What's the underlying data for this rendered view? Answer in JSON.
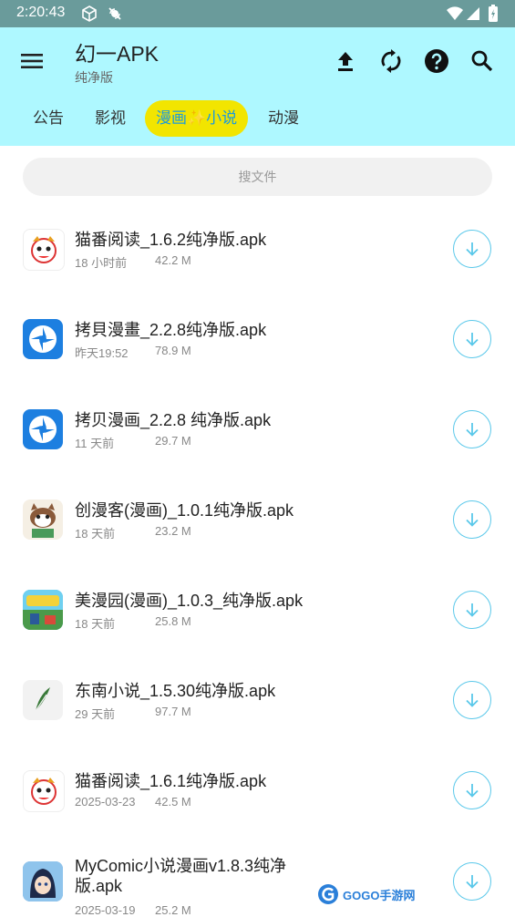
{
  "status_bar": {
    "time": "2:20:43"
  },
  "app_bar": {
    "title": "幻一APK",
    "subtitle": "纯净版",
    "actions": [
      "upload-icon",
      "sync-icon",
      "help-icon",
      "search-icon"
    ]
  },
  "tabs": [
    {
      "label": "公告",
      "active": false
    },
    {
      "label": "影视",
      "active": false
    },
    {
      "label": "漫画✨小说",
      "active": true
    },
    {
      "label": "动漫",
      "active": false
    }
  ],
  "search": {
    "placeholder": "搜文件"
  },
  "files": [
    {
      "name": "猫番阅读_1.6.2纯净版.apk",
      "date": "18 小时前",
      "size": "42.2 M",
      "icon": "maofan-app-icon"
    },
    {
      "name": "拷貝漫畫_2.2.8纯净版.apk",
      "date": "昨天19:52",
      "size": "78.9 M",
      "icon": "kaobei-app-icon"
    },
    {
      "name": "拷贝漫画_2.2.8 纯净版.apk",
      "date": "11 天前",
      "size": "29.7 M",
      "icon": "kaobei-app-icon"
    },
    {
      "name": "创漫客(漫画)_1.0.1纯净版.apk",
      "date": "18 天前",
      "size": "23.2 M",
      "icon": "raccoon-app-icon"
    },
    {
      "name": "美漫园(漫画)_1.0.3_纯净版.apk",
      "date": "18 天前",
      "size": "25.8 M",
      "icon": "meimanyuan-app-icon"
    },
    {
      "name": "东南小说_1.5.30纯净版.apk",
      "date": "29 天前",
      "size": "97.7 M",
      "icon": "feather-app-icon"
    },
    {
      "name": "猫番阅读_1.6.1纯净版.apk",
      "date": "2025-03-23",
      "size": "42.5 M",
      "icon": "maofan-app-icon"
    },
    {
      "name": "MyComic小说漫画v1.8.3纯净版.apk",
      "date": "2025-03-19",
      "size": "25.2 M",
      "icon": "mycomic-app-icon"
    }
  ],
  "watermark": {
    "text": "GOGO手游网"
  },
  "colors": {
    "app_bar": "#aef8ff",
    "active_tab": "#f2e500",
    "active_tab_text": "#1a9adf",
    "download": "#5ac8ea"
  }
}
